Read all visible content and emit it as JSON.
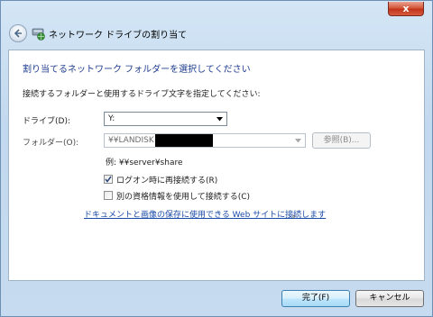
{
  "window": {
    "title": "ネットワーク ドライブの割り当て",
    "close_label": "x"
  },
  "main": {
    "heading": "割り当てるネットワーク フォルダーを選択してください",
    "instruction": "接続するフォルダーと使用するドライブ文字を指定してください:",
    "drive": {
      "label": "ドライブ(D):",
      "value": "Y:"
    },
    "folder": {
      "label": "フォルダー(O):",
      "value": "¥¥LANDISK"
    },
    "browse_label": "参照(B)...",
    "example": "例: ¥¥server¥share",
    "reconnect": {
      "label": "ログオン時に再接続する(R)",
      "checked": true
    },
    "other_credentials": {
      "label": "別の資格情報を使用して接続する(C)",
      "checked": false
    },
    "link_text": "ドキュメントと画像の保存に使用できる Web サイトに接続します",
    "link_suffix": "。"
  },
  "footer": {
    "finish_label": "完了(F)",
    "cancel_label": "キャンセル"
  },
  "colors": {
    "heading": "#1e3d8f",
    "link": "#1a4aa7",
    "close_button": "#c2351b"
  },
  "icons": [
    "back-arrow-icon",
    "network-drive-icon",
    "chevron-down-icon",
    "checkmark-icon"
  ]
}
